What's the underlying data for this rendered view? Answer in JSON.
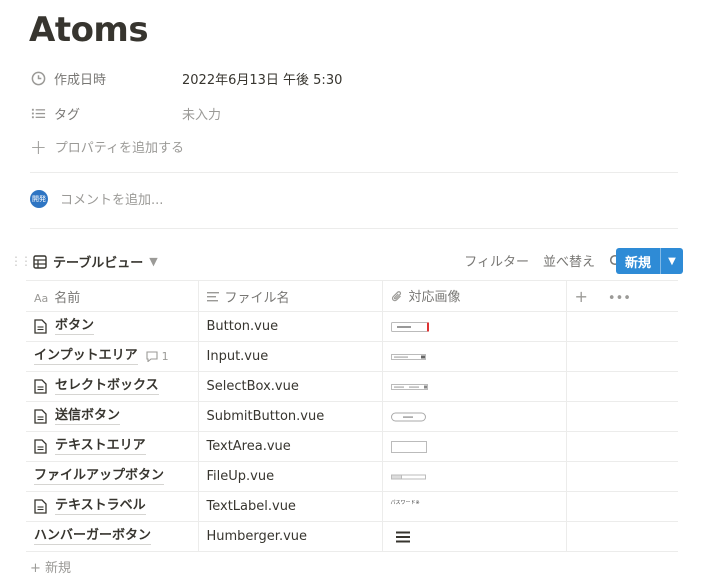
{
  "page": {
    "title": "Atoms"
  },
  "properties": [
    {
      "icon": "clock-icon",
      "name": "作成日時",
      "value": "2022年6月13日 午後 5:30"
    },
    {
      "icon": "list-icon",
      "name": "タグ",
      "value": "未入力"
    }
  ],
  "add_property_label": "プロパティを追加する",
  "comment": {
    "avatar_text": "開発",
    "placeholder": "コメントを追加..."
  },
  "database": {
    "view_label": "テーブルビュー",
    "toolbar": {
      "filter": "フィルター",
      "sort": "並べ替え",
      "new": "新規"
    },
    "columns": [
      {
        "icon": "text-icon",
        "label": "名前"
      },
      {
        "icon": "lines-icon",
        "label": "ファイル名"
      },
      {
        "icon": "attachment-icon",
        "label": "対応画像"
      }
    ],
    "rows": [
      {
        "name": "ボタン",
        "doc": true,
        "file": "Button.vue",
        "thumb": "button"
      },
      {
        "name": "インプットエリア",
        "doc": false,
        "comments": "1",
        "file": "Input.vue",
        "thumb": "input"
      },
      {
        "name": "セレクトボックス",
        "doc": true,
        "file": "SelectBox.vue",
        "thumb": "select"
      },
      {
        "name": "送信ボタン",
        "doc": true,
        "file": "SubmitButton.vue",
        "thumb": "submit"
      },
      {
        "name": "テキストエリア",
        "doc": true,
        "file": "TextArea.vue",
        "thumb": "textarea"
      },
      {
        "name": "ファイルアップボタン",
        "doc": false,
        "file": "FileUp.vue",
        "thumb": "fileup"
      },
      {
        "name": "テキストラベル",
        "doc": true,
        "file": "TextLabel.vue",
        "thumb": "label"
      },
      {
        "name": "ハンバーガーボタン",
        "doc": false,
        "file": "Humberger.vue",
        "thumb": "hamburger"
      }
    ],
    "thumb_texts": {
      "label": "パスワード※"
    },
    "new_row_label": "新規"
  },
  "colors": {
    "accent": "#2e8bd6",
    "text": "#37352f",
    "muted": "#9b9a97"
  }
}
